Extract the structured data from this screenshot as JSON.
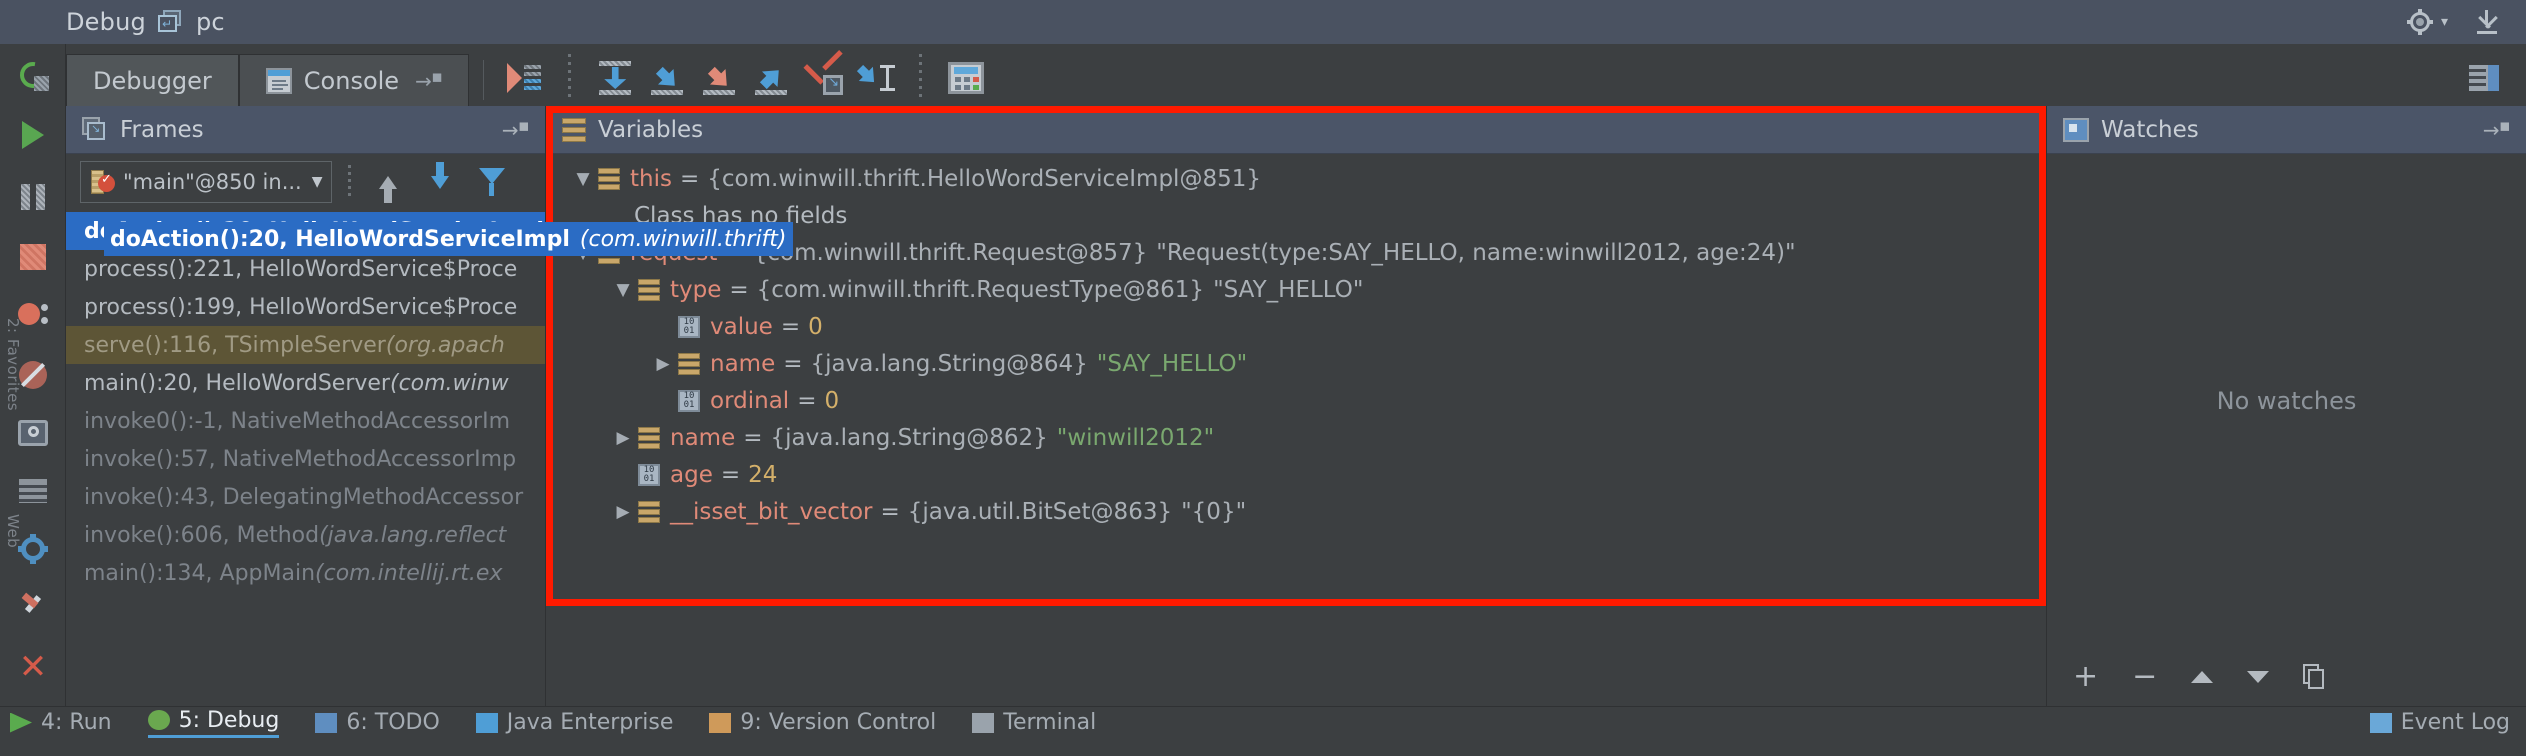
{
  "titlebar": {
    "label": "Debug",
    "restore_icon": "restore-window-icon",
    "config_name": "pc",
    "settings_icon": "gear-icon",
    "minimize_icon": "hide-icon"
  },
  "rail": {
    "vertical_labels": [
      "2: Favorites",
      "Web"
    ],
    "buttons": [
      {
        "name": "rerun-button",
        "icon": "rerun-icon"
      },
      {
        "name": "resume-program-button",
        "icon": "resume-icon"
      },
      {
        "name": "pause-program-button",
        "icon": "pause-icon"
      },
      {
        "name": "stop-button",
        "icon": "stop-icon"
      },
      {
        "name": "view-breakpoints-button",
        "icon": "breakpoints-icon"
      },
      {
        "name": "mute-breakpoints-button",
        "icon": "mute-breakpoints-icon"
      },
      {
        "name": "screenshot-button",
        "icon": "camera-icon"
      },
      {
        "name": "layout-button",
        "icon": "grid-icon"
      },
      {
        "name": "settings-button",
        "icon": "settings-gear-icon"
      },
      {
        "name": "pin-tab-button",
        "icon": "pin-icon"
      },
      {
        "name": "close-button",
        "icon": "close-x-icon"
      },
      {
        "name": "help-button",
        "icon": "question-mark-icon"
      },
      {
        "name": "restore-layout-button",
        "icon": "layout-panel-icon"
      }
    ]
  },
  "tabs": [
    {
      "label": "Debugger",
      "active": true,
      "icon": null
    },
    {
      "label": "Console",
      "active": false,
      "icon": "console-icon",
      "arrow": "→"
    }
  ],
  "toolbar": {
    "buttons": [
      {
        "name": "evaluate-expression-button",
        "icon": "evaluate-icon"
      },
      {
        "name": "step-over-button",
        "icon": "step-over-icon"
      },
      {
        "name": "step-into-button",
        "icon": "step-into-icon"
      },
      {
        "name": "force-step-into-button",
        "icon": "force-step-into-icon"
      },
      {
        "name": "step-out-button",
        "icon": "step-out-icon"
      },
      {
        "name": "drop-frame-button",
        "icon": "drop-frame-icon"
      },
      {
        "name": "run-to-cursor-button",
        "icon": "run-to-cursor-icon"
      },
      {
        "name": "evaluate-calculator-button",
        "icon": "calculator-icon"
      }
    ],
    "restore_layout": "restore-layout-icon"
  },
  "frames": {
    "title": "Frames",
    "icon": "frames-icon",
    "collapse_arrow": "→",
    "thread": {
      "label": "\"main\"@850 in...",
      "icon": "thread-suspended-icon",
      "caret": "▼"
    },
    "toolbar": [
      {
        "name": "frames-up-button",
        "icon": "arrow-up-icon"
      },
      {
        "name": "frames-down-button",
        "icon": "arrow-down-icon"
      },
      {
        "name": "frames-filter-button",
        "icon": "funnel-icon"
      }
    ],
    "rows": [
      {
        "text": "doAction():20, HelloWordServiceImpl",
        "pkg": "",
        "state": "selected"
      },
      {
        "text": "process():221, HelloWordService$Proce",
        "pkg": "",
        "state": "normal"
      },
      {
        "text": "process():199, HelloWordService$Proce",
        "pkg": "",
        "state": "normal"
      },
      {
        "text": "serve():116, TSimpleServer ",
        "pkg": "(org.apach",
        "state": "library"
      },
      {
        "text": "main():20, HelloWordServer ",
        "pkg": "(com.winw",
        "state": "normal"
      },
      {
        "text": "invoke0():-1, NativeMethodAccessorIm",
        "pkg": "",
        "state": "dim"
      },
      {
        "text": "invoke():57, NativeMethodAccessorImp",
        "pkg": "",
        "state": "dim"
      },
      {
        "text": "invoke():43, DelegatingMethodAccessor",
        "pkg": "",
        "state": "dim"
      },
      {
        "text": "invoke():606, Method ",
        "pkg": "(java.lang.reflect",
        "state": "dim"
      },
      {
        "text": "main():134, AppMain ",
        "pkg": "(com.intellij.rt.ex",
        "state": "dim"
      }
    ],
    "tooltip": {
      "text": "doAction():20, HelloWordServiceImpl",
      "pkg": "(com.winwill.thrift)"
    }
  },
  "variables": {
    "title": "Variables",
    "icon": "variables-icon",
    "highlight_color": "#ff1a00",
    "rows": [
      {
        "indent": 0,
        "caret": "▼",
        "icon": "object-icon",
        "name": "this",
        "eq": "=",
        "value_plain": "{com.winwill.thrift.HelloWordServiceImpl@851}",
        "value_string": ""
      },
      {
        "indent": 1,
        "caret": "",
        "icon": "none",
        "name": "",
        "eq": "",
        "value_plain": "Class has no fields",
        "value_string": ""
      },
      {
        "indent": 0,
        "caret": "▼",
        "icon": "object-icon",
        "name": "request",
        "eq": "=",
        "value_plain": "{com.winwill.thrift.Request@857}",
        "value_string": "\"Request(type:SAY_HELLO, name:winwill2012, age:24)\""
      },
      {
        "indent": 1,
        "caret": "▼",
        "icon": "object-icon",
        "name": "type",
        "eq": "=",
        "value_plain": "{com.winwill.thrift.RequestType@861}",
        "value_string": "\"SAY_HELLO\""
      },
      {
        "indent": 2,
        "caret": "",
        "icon": "primitive-icon",
        "name": "value",
        "eq": "=",
        "value_plain": "",
        "value_number": "0"
      },
      {
        "indent": 2,
        "caret": "▶",
        "icon": "object-icon",
        "name": "name",
        "eq": "=",
        "value_plain": "{java.lang.String@864}",
        "value_string": "\"SAY_HELLO\""
      },
      {
        "indent": 2,
        "caret": "",
        "icon": "primitive-icon",
        "name": "ordinal",
        "eq": "=",
        "value_plain": "",
        "value_number": "0"
      },
      {
        "indent": 1,
        "caret": "▶",
        "icon": "object-icon",
        "name": "name",
        "eq": "=",
        "value_plain": "{java.lang.String@862}",
        "value_string": "\"winwill2012\""
      },
      {
        "indent": 1,
        "caret": "",
        "icon": "primitive-icon",
        "name": "age",
        "eq": "=",
        "value_plain": "",
        "value_number": "24"
      },
      {
        "indent": 1,
        "caret": "▶",
        "icon": "object-icon",
        "name": "__isset_bit_vector",
        "eq": "=",
        "value_plain": "{java.util.BitSet@863}",
        "value_string": "\"{0}\""
      }
    ]
  },
  "watches": {
    "title": "Watches",
    "icon": "watches-icon",
    "collapse_arrow": "→",
    "empty_text": "No watches",
    "toolbar": [
      {
        "name": "add-watch-button",
        "icon": "plus-icon",
        "glyph": "+"
      },
      {
        "name": "remove-watch-button",
        "icon": "minus-icon",
        "glyph": "−"
      },
      {
        "name": "move-watch-up-button",
        "icon": "arrow-up-icon"
      },
      {
        "name": "move-watch-down-button",
        "icon": "arrow-down-icon"
      },
      {
        "name": "duplicate-watch-button",
        "icon": "copy-icon"
      }
    ]
  },
  "statusbar": {
    "items": [
      {
        "label": "4: Run",
        "icon": "run-icon",
        "active": false
      },
      {
        "label": "5: Debug",
        "icon": "debug-icon",
        "active": true
      },
      {
        "label": "6: TODO",
        "icon": "todo-icon",
        "active": false
      },
      {
        "label": "Java Enterprise",
        "icon": "java-enterprise-icon",
        "active": false
      },
      {
        "label": "9: Version Control",
        "icon": "version-control-icon",
        "active": false
      },
      {
        "label": "Terminal",
        "icon": "terminal-icon",
        "active": false
      }
    ],
    "right": {
      "label": "Event Log",
      "icon": "event-log-icon"
    }
  }
}
